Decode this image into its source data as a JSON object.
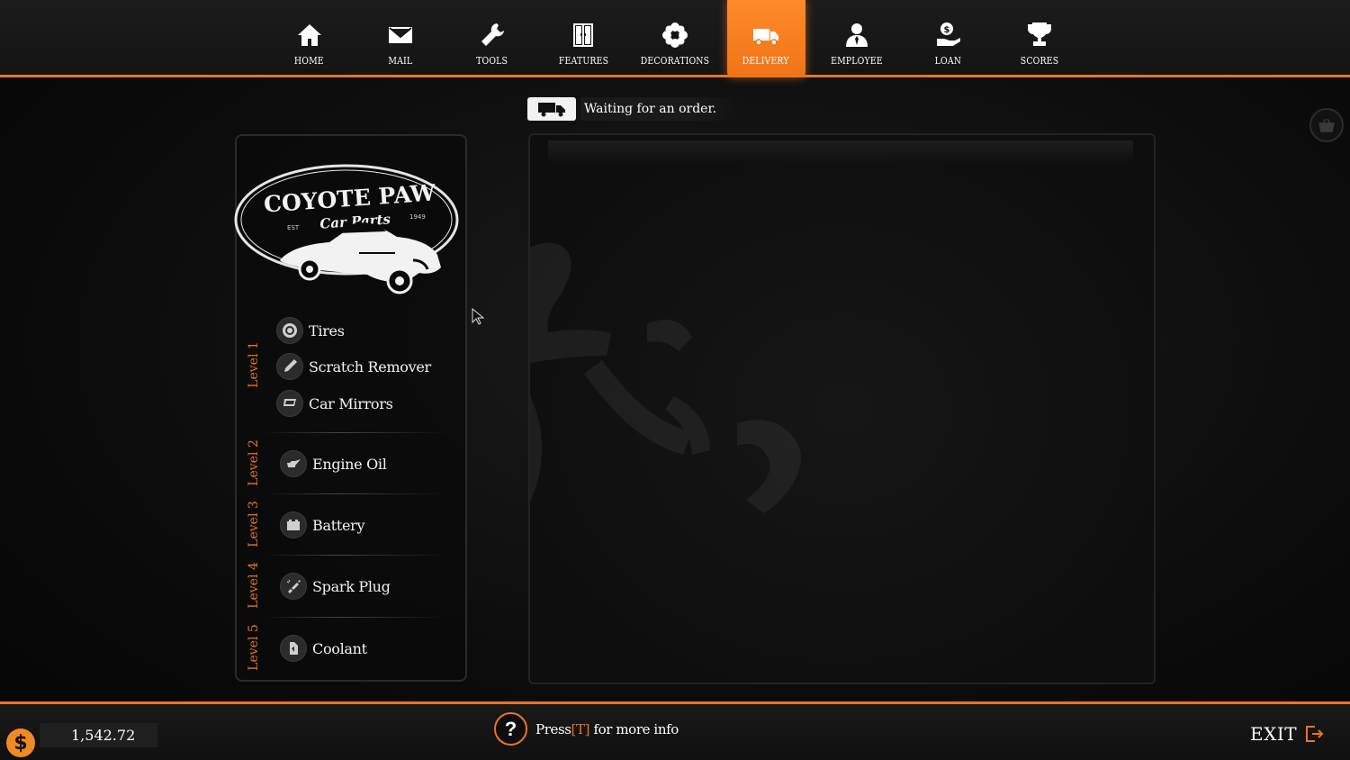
{
  "nav": {
    "items": [
      {
        "label": "HOME",
        "icon": "home-icon"
      },
      {
        "label": "MAIL",
        "icon": "mail-icon"
      },
      {
        "label": "TOOLS",
        "icon": "wrench-icon"
      },
      {
        "label": "FEATURES",
        "icon": "features-icon"
      },
      {
        "label": "DECORATIONS",
        "icon": "flower-icon"
      },
      {
        "label": "DELIVERY",
        "icon": "truck-icon",
        "active": true
      },
      {
        "label": "EMPLOYEE",
        "icon": "person-icon"
      },
      {
        "label": "LOAN",
        "icon": "coin-hand-icon"
      },
      {
        "label": "SCORES",
        "icon": "trophy-icon"
      }
    ]
  },
  "status": {
    "text": "Waiting for an order."
  },
  "store": {
    "name": "COYOTE PAW",
    "subtitle": "Car Parts",
    "est": "EST",
    "year": "1949"
  },
  "levels": [
    {
      "label": "Level 1",
      "parts": [
        {
          "name": "Tires",
          "icon": "tire-icon"
        },
        {
          "name": "Scratch Remover",
          "icon": "scratch-remover-icon"
        },
        {
          "name": "Car Mirrors",
          "icon": "mirror-icon"
        }
      ]
    },
    {
      "label": "Level 2",
      "parts": [
        {
          "name": "Engine Oil",
          "icon": "oil-can-icon"
        }
      ]
    },
    {
      "label": "Level 3",
      "parts": [
        {
          "name": "Battery",
          "icon": "battery-icon"
        }
      ]
    },
    {
      "label": "Level 4",
      "parts": [
        {
          "name": "Spark Plug",
          "icon": "spark-plug-icon"
        }
      ]
    },
    {
      "label": "Level 5",
      "parts": [
        {
          "name": "Coolant",
          "icon": "coolant-icon"
        }
      ]
    }
  ],
  "footer": {
    "money": "1,542.72",
    "currency_symbol": "$",
    "help_prefix": "Press",
    "help_key": "[T]",
    "help_suffix": "for more info",
    "help_symbol": "?",
    "exit_label": "EXIT"
  },
  "colors": {
    "accent": "#e9761f",
    "active_tab": "#f07417"
  }
}
